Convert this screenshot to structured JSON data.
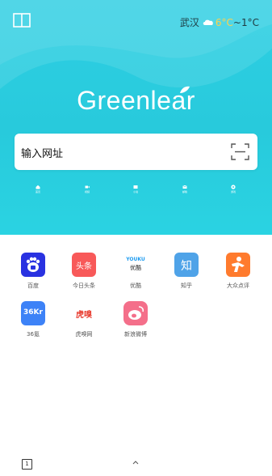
{
  "weather": {
    "city": "武汉",
    "high": "6°C",
    "separator": " ~ ",
    "low": "1°C",
    "icon": "cloud-icon"
  },
  "logo": {
    "text": "Greenlear"
  },
  "search": {
    "placeholder": "输入网址",
    "scan_icon": "scan-icon"
  },
  "quick_links": [
    {
      "icon": "home-icon",
      "label": "首页"
    },
    {
      "icon": "video-icon",
      "label": "视频"
    },
    {
      "icon": "novel-icon",
      "label": "小说"
    },
    {
      "icon": "mail-icon",
      "label": "邮箱"
    },
    {
      "icon": "game-icon",
      "label": "游戏"
    }
  ],
  "apps": [
    {
      "label": "百度",
      "icon": "baidu-icon",
      "color": "#2932e1"
    },
    {
      "label": "今日头条",
      "icon": "toutiao-icon",
      "color": "#f85959",
      "glyph": "头条"
    },
    {
      "label": "优酷",
      "icon": "youku-icon",
      "color": "#ffffff",
      "glyph_top": "YOUKU",
      "glyph_bottom": "优酷"
    },
    {
      "label": "知乎",
      "icon": "zhihu-icon",
      "color": "#4fa3e8",
      "glyph": "知"
    },
    {
      "label": "大众点评",
      "icon": "dianping-icon",
      "color": "#ff7b2e"
    },
    {
      "label": "36氪",
      "icon": "36kr-icon",
      "color": "#3d82f7",
      "glyph": "36Kr"
    },
    {
      "label": "虎嗅网",
      "icon": "huxiu-icon",
      "color": "#ffffff",
      "glyph": "虎嗅"
    },
    {
      "label": "新浪微博",
      "icon": "weibo-icon",
      "color": "#f46f8a"
    }
  ],
  "bottom_bar": {
    "tab_count": "1",
    "up_icon": "chevron-up-icon"
  }
}
